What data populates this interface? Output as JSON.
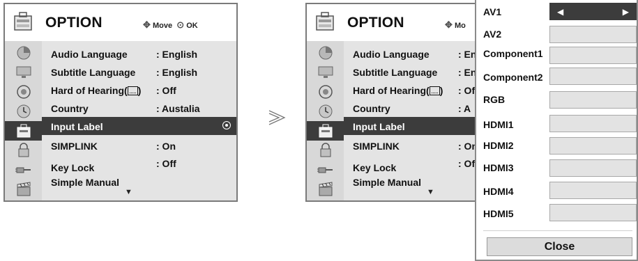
{
  "left_panel": {
    "title": "OPTION",
    "help_move": "Move",
    "help_ok": "OK",
    "menu": [
      {
        "label": "Audio Language",
        "value": ": English"
      },
      {
        "label": "Subtitle Language",
        "value": ": English"
      },
      {
        "label_pre": "Hard of Hearing(",
        "label_post": ")",
        "value": ": Off"
      },
      {
        "label": "Country",
        "value": ":  Austalia"
      },
      {
        "label": "Input Label",
        "value": "",
        "highlighted": true
      },
      {
        "label": "SIMPLINK",
        "value": ": On"
      },
      {
        "label": "Key Lock",
        "value": ": Off"
      },
      {
        "label": "Simple Manual",
        "value": ""
      }
    ],
    "more_indicator": "▼"
  },
  "right_panel": {
    "title": "OPTION",
    "help_move_partial": "Mo",
    "menu": [
      {
        "label": "Audio Language",
        "value": ": En"
      },
      {
        "label": "Subtitle Language",
        "value": ": En"
      },
      {
        "label_pre": "Hard of Hearing(",
        "label_post": ")",
        "value": ": Of"
      },
      {
        "label": "Country",
        "value": ":  A"
      },
      {
        "label": "Input Label",
        "value": "",
        "highlighted": true
      },
      {
        "label": "SIMPLINK",
        "value": ": On"
      },
      {
        "label": "Key Lock",
        "value": ": Of"
      },
      {
        "label": "Simple Manual",
        "value": ""
      }
    ],
    "more_indicator": "▼"
  },
  "transition_arrow": "≫",
  "input_label_popup": {
    "items": [
      {
        "label": "AV1",
        "active": true
      },
      {
        "label": "AV2"
      },
      {
        "label": "Component1"
      },
      {
        "label": "Component2"
      },
      {
        "label": "RGB"
      },
      {
        "label": "HDMI1"
      },
      {
        "label": "HDMI2"
      },
      {
        "label": "HDMI3"
      },
      {
        "label": "HDMI4"
      },
      {
        "label": "HDMI5"
      }
    ],
    "left_arrow": "◀",
    "right_arrow": "▶",
    "close_label": "Close"
  },
  "colors": {
    "highlight": "#3c3c3c",
    "menu_background": "#e4e4e4",
    "sidebar_background": "#d8d8d8",
    "input_box": "#e3e3e3"
  },
  "sidebar_icons": [
    "picture-icon",
    "screen-icon",
    "audio-icon",
    "clock-icon",
    "option-icon",
    "lock-icon",
    "input-icon",
    "usb-movie-icon"
  ]
}
